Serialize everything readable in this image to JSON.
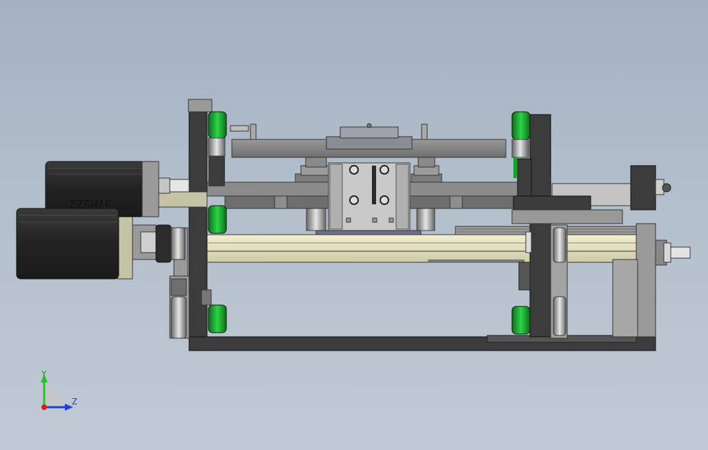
{
  "model": {
    "motor_label": "57HS22"
  },
  "triad": {
    "y_label": "Y",
    "z_label": "Z"
  },
  "colors": {
    "background_top": "#a3b1c1",
    "background_bottom": "#c1cad4",
    "frame_dark": "#3c3c3c",
    "motor_body": "#2a2a2a",
    "wheel_green": "#14a32a",
    "bracket_khaki": "#c4c3a6",
    "rail_light": "#e4e1bf",
    "metal_gray": "#858585",
    "axis_y": "#22c422",
    "axis_z": "#1f3fd6",
    "axis_x": "#d11f1f"
  }
}
